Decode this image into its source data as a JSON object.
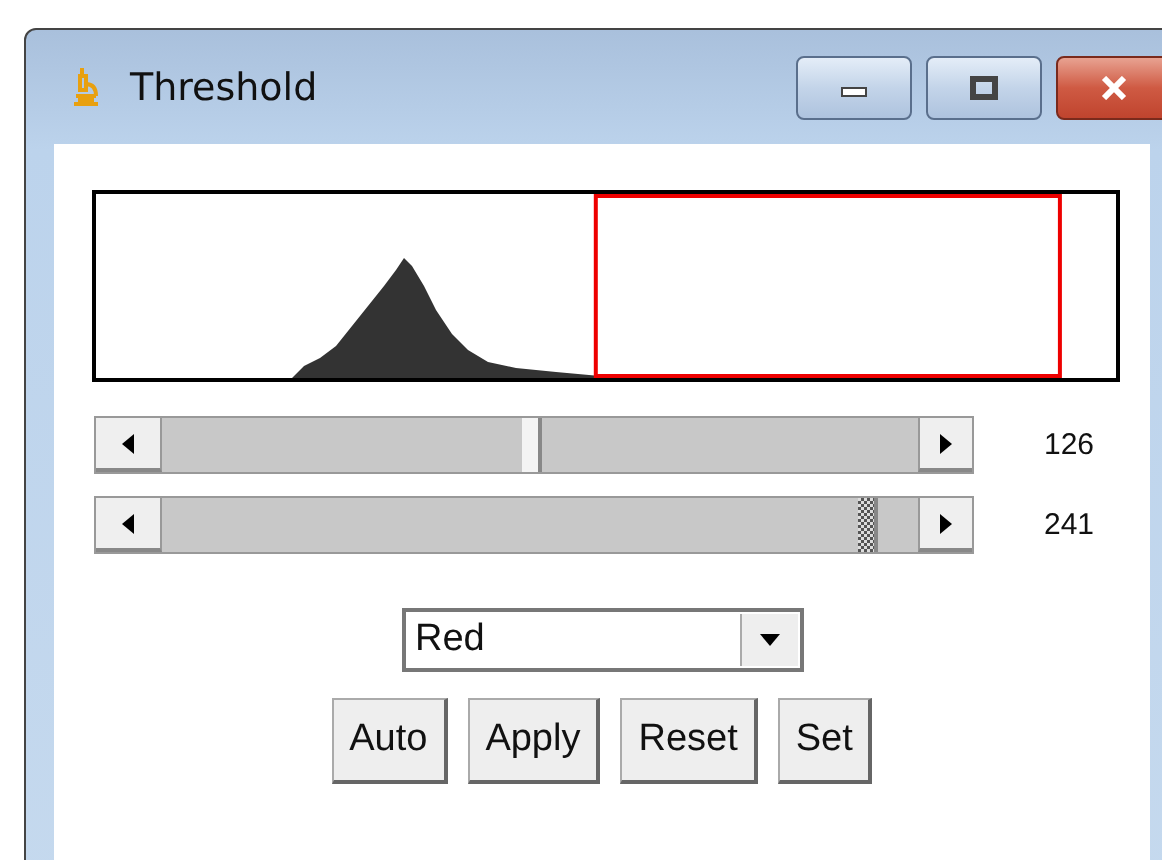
{
  "window": {
    "title": "Threshold"
  },
  "sliders": [
    {
      "focused": false,
      "reading": "126"
    },
    {
      "focused": true,
      "reading": "241"
    }
  ],
  "dropdown": {
    "value": "Red"
  },
  "buttons": [
    "Auto",
    "Apply",
    "Reset",
    "Set"
  ]
}
